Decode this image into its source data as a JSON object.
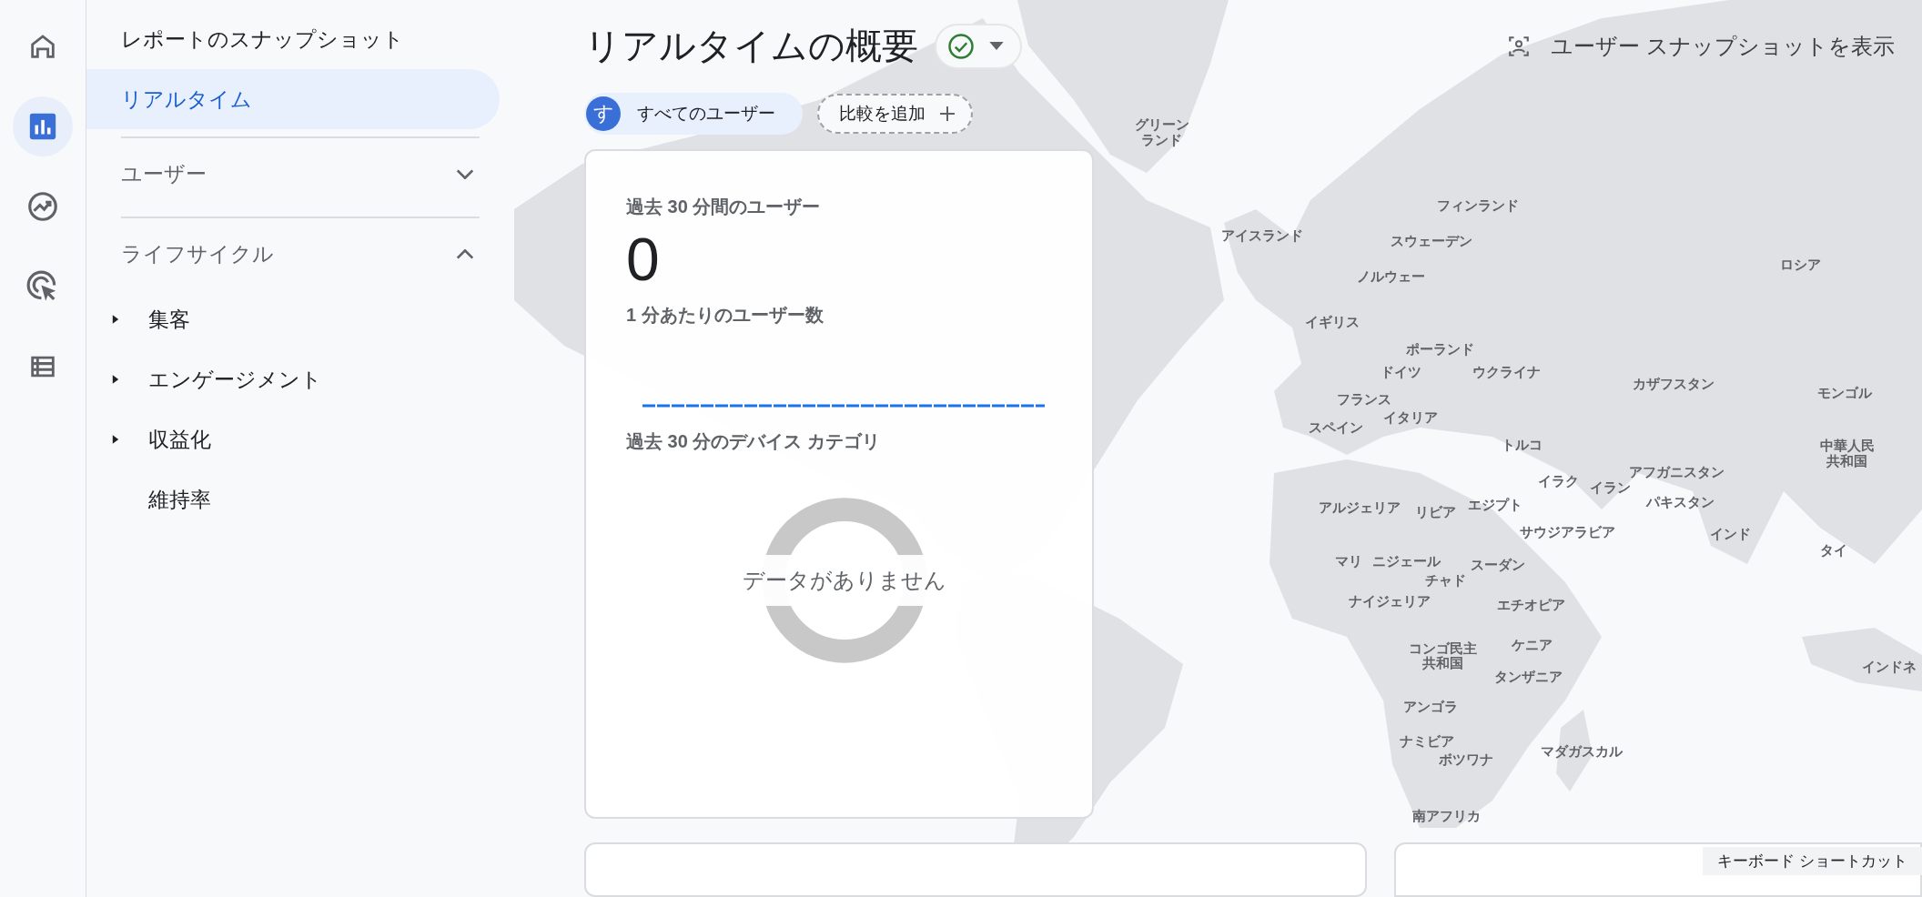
{
  "nav_rail": [
    {
      "kind": "home",
      "selected": false
    },
    {
      "kind": "reports",
      "selected": true
    },
    {
      "kind": "explore",
      "selected": false
    },
    {
      "kind": "advertising",
      "selected": false
    },
    {
      "kind": "configure",
      "selected": false
    }
  ],
  "sidebar": {
    "links": [
      {
        "label": "レポートのスナップショット",
        "selected": false
      },
      {
        "label": "リアルタイム",
        "selected": true
      }
    ],
    "sections": [
      {
        "label": "ユーザー",
        "expanded": false
      },
      {
        "label": "ライフサイクル",
        "expanded": true,
        "children": [
          {
            "label": "集客",
            "expandable": true
          },
          {
            "label": "エンゲージメント",
            "expandable": true
          },
          {
            "label": "収益化",
            "expandable": true
          },
          {
            "label": "維持率",
            "expandable": false
          }
        ]
      }
    ]
  },
  "header": {
    "title": "リアルタイムの概要",
    "status_ok": true,
    "snapshot_button": "ユーザー スナップショットを表示"
  },
  "comparisons": {
    "segments": [
      {
        "avatar": "す",
        "label": "すべてのユーザー"
      }
    ],
    "add_button": "比較を追加"
  },
  "card": {
    "users_label": "過去 30 分間のユーザー",
    "users_value": "0",
    "per_minute_label": "1 分あたりのユーザー数",
    "device_label": "過去 30 分のデバイス カテゴリ",
    "empty_message": "データがありません"
  },
  "map_labels": [
    "グリーンランド",
    "フィンランド",
    "アイスランド",
    "スウェーデン",
    "ロシア",
    "ノルウェー",
    "イギリス",
    "ポーランド",
    "ドイツ",
    "ウクライナ",
    "カザフスタン",
    "モンゴル",
    "フランス",
    "イタリア",
    "スペイン",
    "トルコ",
    "中華人民共和国",
    "アフガニスタン",
    "イラク",
    "イラン",
    "パキスタン",
    "アルジェリア",
    "リビア",
    "エジプト",
    "サウジアラビア",
    "インド",
    "タイ",
    "マリ",
    "ニジェール",
    "チャド",
    "スーダン",
    "ナイジェリア",
    "エチオピア",
    "インドネ",
    "コンゴ民主共和国",
    "ケニア",
    "タンザニア",
    "アンゴラ",
    "ナミビア",
    "マダガスカル",
    "ボツワナ",
    "南アフリカ"
  ],
  "keyboard_shortcuts": "キーボード ショートカット"
}
